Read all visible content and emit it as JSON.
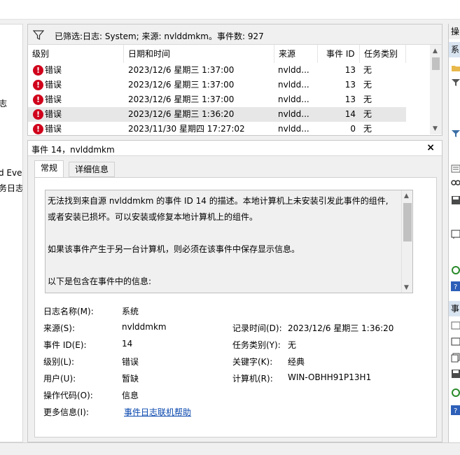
{
  "filter": {
    "text": "已筛选:日志: System; 来源: nvlddmkm。事件数: 927"
  },
  "left_fragments": [
    "志",
    "d Eve",
    "务日志"
  ],
  "grid": {
    "columns": [
      "级别",
      "日期和时间",
      "来源",
      "事件 ID",
      "任务类别"
    ],
    "rows": [
      {
        "level": "错误",
        "datetime": "2023/12/6 星期三 1:37:00",
        "source": "nvldd...",
        "id": "13",
        "task": "无"
      },
      {
        "level": "错误",
        "datetime": "2023/12/6 星期三 1:37:00",
        "source": "nvldd...",
        "id": "13",
        "task": "无"
      },
      {
        "level": "错误",
        "datetime": "2023/12/6 星期三 1:37:00",
        "source": "nvldd...",
        "id": "13",
        "task": "无"
      },
      {
        "level": "错误",
        "datetime": "2023/12/6 星期三 1:36:20",
        "source": "nvldd...",
        "id": "14",
        "task": "无"
      },
      {
        "level": "错误",
        "datetime": "2023/11/30 星期四 17:27:02",
        "source": "nvldd...",
        "id": "0",
        "task": "无"
      }
    ]
  },
  "detail": {
    "title": "事件 14，nvlddmkm",
    "close": "×",
    "tabs": [
      "常规",
      "详细信息"
    ],
    "description": [
      "无法找到来自源 nvlddmkm 的事件 ID 14 的描述。本地计算机上未安装引发此事件的组件,",
      "或者安装已损坏。可以安装或修复本地计算机上的组件。",
      "如果该事件产生于另一台计算机，则必须在该事件中保存显示信息。",
      "以下是包含在事件中的信息:"
    ],
    "props": {
      "log_name_label": "日志名称(M):",
      "log_name": "系统",
      "source_label": "来源(S):",
      "source": "nvlddmkm",
      "logged_label": "记录时间(D):",
      "logged": "2023/12/6 星期三 1:36:20",
      "event_id_label": "事件 ID(E):",
      "event_id": "14",
      "task_label": "任务类别(Y):",
      "task": "无",
      "level_label": "级别(L):",
      "level": "错误",
      "keywords_label": "关键字(K):",
      "keywords": "经典",
      "user_label": "用户(U):",
      "user": "暂缺",
      "computer_label": "计算机(R):",
      "computer": "WIN-OBHH91P13H1",
      "opcode_label": "操作代码(O):",
      "opcode": "信息",
      "more_label": "更多信息(I):",
      "more_link": "事件日志联机帮助"
    }
  },
  "right_pane": {
    "header1": "操",
    "header2": "系",
    "header3": "事"
  },
  "icons": {
    "error": "error-icon",
    "filter": "filter-funnel-icon"
  }
}
